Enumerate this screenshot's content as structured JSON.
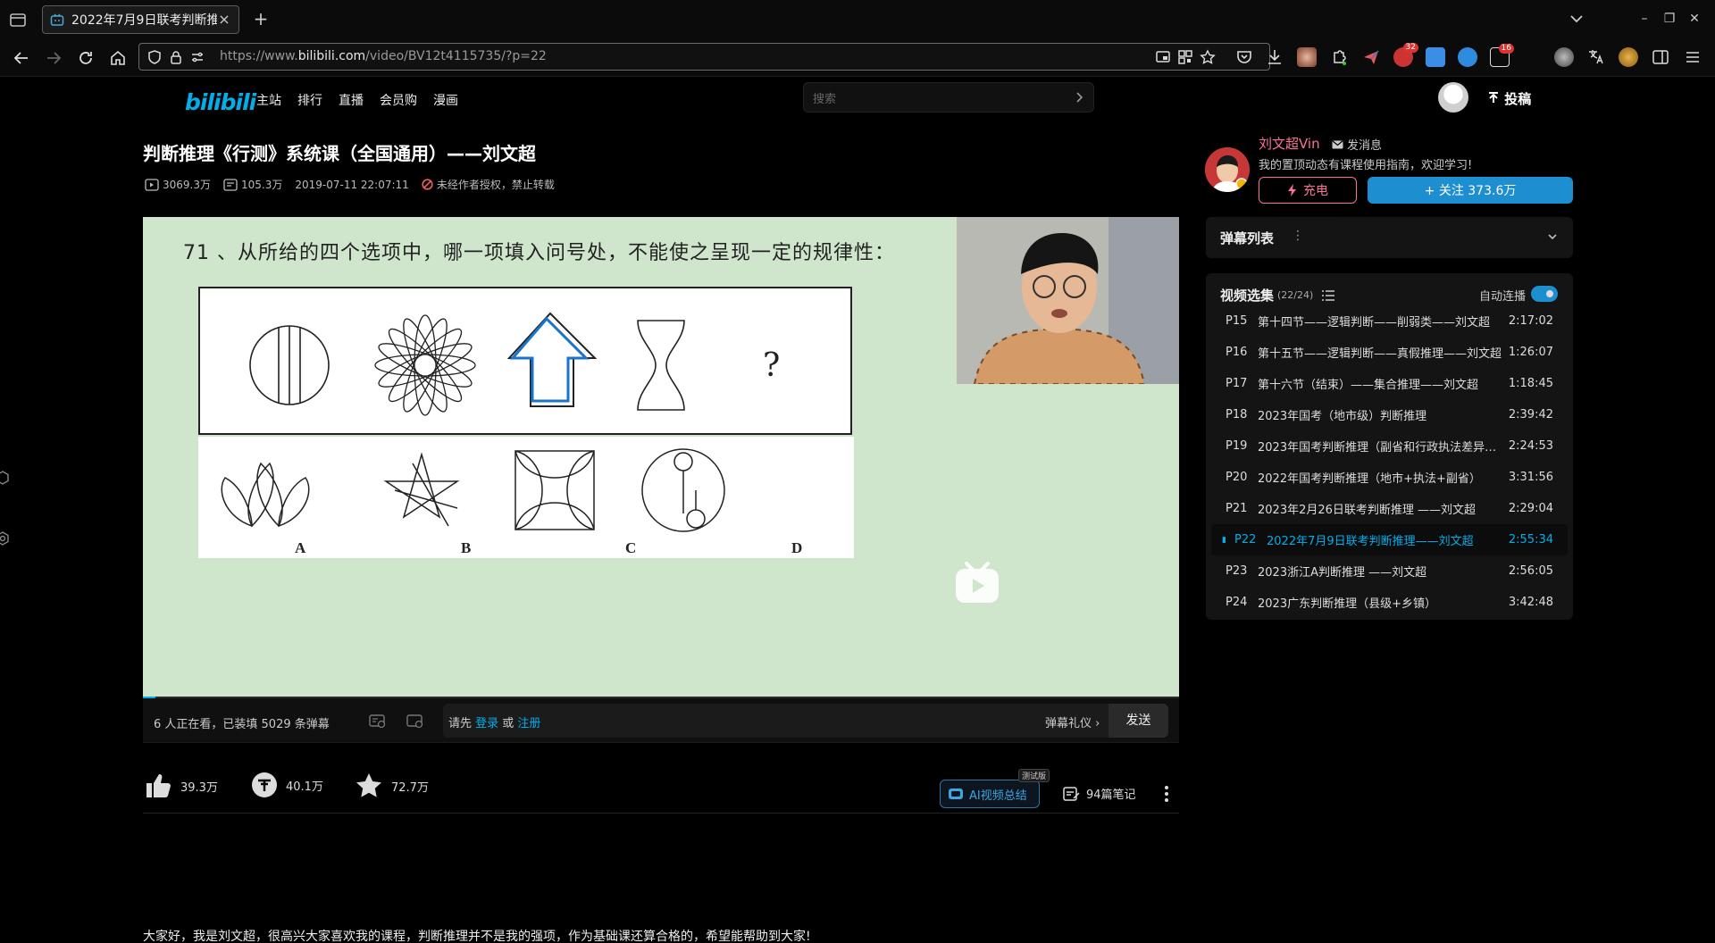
{
  "browser": {
    "tab_title": "2022年7月9日联考判断推",
    "url_prefix": "https://www.",
    "url_host": "bilibili.com",
    "url_path": "/video/BV12t4115735/?p=22",
    "ext_badge_1": "32",
    "ext_badge_2": "16"
  },
  "site": {
    "logo": "bilibili",
    "nav": [
      "主站",
      "排行",
      "直播",
      "会员购",
      "漫画"
    ],
    "search_placeholder": "搜索",
    "upload": "投稿"
  },
  "video": {
    "title": "判断推理《行测》系统课（全国通用）——刘文超",
    "views": "3069.3万",
    "danmaku": "105.3万",
    "date": "2019-07-11 22:07:11",
    "copyright": "未经作者授权，禁止转载",
    "question": "71 、从所给的四个选项中，哪一项填入问号处，不能使之呈现一定的规律性：",
    "qmark": "?",
    "opt_labels": [
      "A",
      "B",
      "C",
      "D"
    ],
    "progress_fraction": 0.012
  },
  "danmaku_bar": {
    "viewers": "6 人正在看，已装填 5029 条弹幕",
    "login_prefix": "请先 ",
    "login": "登录",
    "or": " 或 ",
    "register": "注册",
    "etiquette": "弹幕礼仪",
    "send": "发送"
  },
  "actions": {
    "like": "39.3万",
    "coin": "40.1万",
    "fav": "72.7万",
    "ai_summary": "AI视频总结",
    "beta": "测试版",
    "notes": "94篇笔记"
  },
  "description": "大家好，我是刘文超，很高兴大家喜欢我的课程，判断推理并不是我的强项，作为基础课还算合格的，希望能帮助到大家!",
  "uploader": {
    "name": "刘文超Vin",
    "message": "发消息",
    "sign": "我的置顶动态有课程使用指南，欢迎学习!",
    "charge": "充电",
    "follow": "+ 关注 373.6万"
  },
  "danmaku_list": {
    "title": "弹幕列表"
  },
  "playlist": {
    "title": "视频选集",
    "count": "(22/24)",
    "autoplay": "自动连播",
    "items": [
      {
        "p": "P15",
        "name": "第十四节——逻辑判断——削弱类——刘文超",
        "dur": "2:17:02"
      },
      {
        "p": "P16",
        "name": "第十五节——逻辑判断——真假推理——刘文超",
        "dur": "1:26:07"
      },
      {
        "p": "P17",
        "name": "第十六节（结束）——集合推理——刘文超",
        "dur": "1:18:45"
      },
      {
        "p": "P18",
        "name": "2023年国考（地市级）判断推理",
        "dur": "2:39:42"
      },
      {
        "p": "P19",
        "name": "2023年国考判断推理（副省和行政执法差异题…",
        "dur": "2:24:53"
      },
      {
        "p": "P20",
        "name": "2022年国考判断推理（地市+执法+副省）",
        "dur": "3:31:56"
      },
      {
        "p": "P21",
        "name": "2023年2月26日联考判断推理 ——刘文超",
        "dur": "2:29:04"
      },
      {
        "p": "P22",
        "name": "2022年7月9日联考判断推理——刘文超",
        "dur": "2:55:34"
      },
      {
        "p": "P23",
        "name": "2023浙江A判断推理 ——刘文超",
        "dur": "2:56:05"
      },
      {
        "p": "P24",
        "name": "2023广东判断推理（县级+乡镇）",
        "dur": "3:42:48"
      }
    ],
    "active_index": 7
  }
}
